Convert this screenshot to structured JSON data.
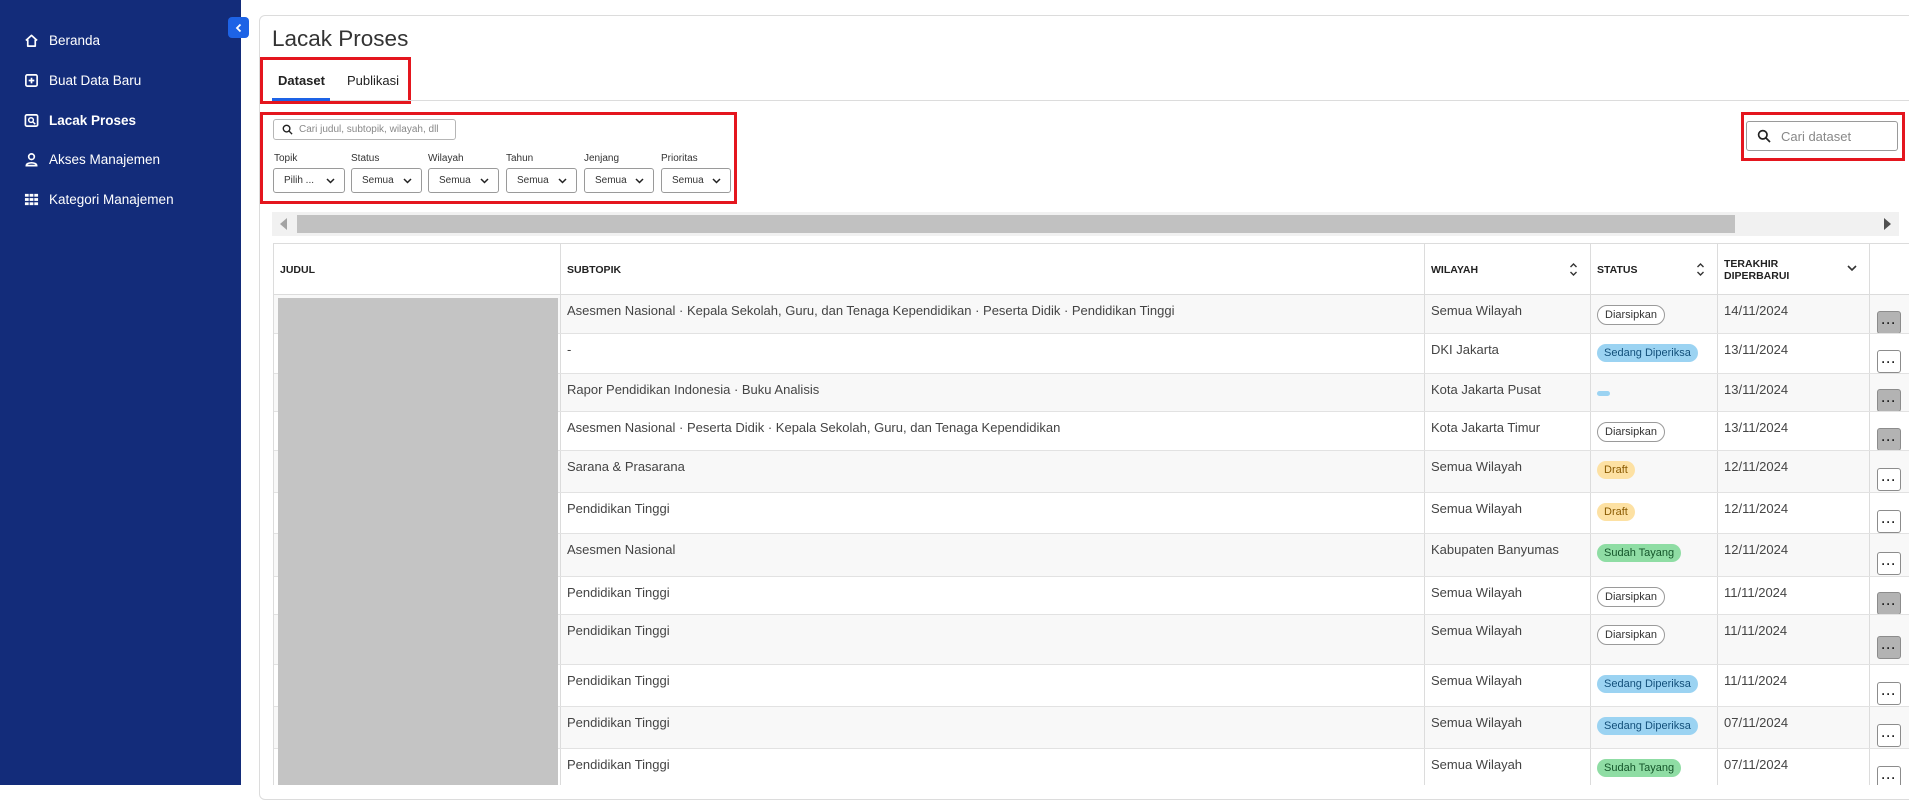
{
  "sidebar": {
    "items": [
      {
        "label": "Beranda",
        "icon": "home-icon"
      },
      {
        "label": "Buat Data Baru",
        "icon": "plus-square-icon"
      },
      {
        "label": "Lacak Proses",
        "icon": "track-search-icon",
        "active": true
      },
      {
        "label": "Akses Manajemen",
        "icon": "user-icon"
      },
      {
        "label": "Kategori Manajemen",
        "icon": "grid-icon"
      }
    ]
  },
  "page": {
    "title": "Lacak Proses"
  },
  "tabs": [
    {
      "label": "Dataset",
      "active": true
    },
    {
      "label": "Publikasi",
      "active": false
    }
  ],
  "filters": {
    "search_placeholder": "Cari judul, subtopik, wilayah, dll",
    "items": [
      {
        "label": "Topik",
        "value": "Pilih ..."
      },
      {
        "label": "Status",
        "value": "Semua"
      },
      {
        "label": "Wilayah",
        "value": "Semua"
      },
      {
        "label": "Tahun",
        "value": "Semua"
      },
      {
        "label": "Jenjang",
        "value": "Semua"
      },
      {
        "label": "Prioritas",
        "value": "Semua"
      }
    ]
  },
  "dataset_search": {
    "placeholder": "Cari dataset"
  },
  "table": {
    "headers": {
      "judul": "JUDUL",
      "subtopik": "SUBTOPIK",
      "wilayah": "WILAYAH",
      "status": "STATUS",
      "terakhir_line1": "TERAKHIR",
      "terakhir_line2": "DIPERBARUI"
    },
    "rows": [
      {
        "subtopik": "Asesmen Nasional  ·  Kepala Sekolah, Guru, dan Tenaga Kependidikan  ·  Peserta Didik  ·  Pendidikan Tinggi",
        "wilayah": "Semua Wilayah",
        "status": "Diarsipkan",
        "status_style": "outline",
        "date": "14/11/2024",
        "more_grey": true
      },
      {
        "subtopik": "-",
        "wilayah": "DKI Jakarta",
        "status": "Sedang Diperiksa",
        "status_style": "blue",
        "date": "13/11/2024",
        "more_grey": false
      },
      {
        "subtopik": "Rapor Pendidikan Indonesia  ·  Buku Analisis",
        "wilayah": "Kota Jakarta Pusat",
        "status": "",
        "status_style": "dash",
        "date": "13/11/2024",
        "more_grey": true
      },
      {
        "subtopik": "Asesmen Nasional  ·  Peserta Didik  ·  Kepala Sekolah, Guru, dan Tenaga Kependidikan",
        "wilayah": "Kota Jakarta Timur",
        "status": "Diarsipkan",
        "status_style": "outline",
        "date": "13/11/2024",
        "more_grey": true
      },
      {
        "subtopik": "Sarana & Prasarana",
        "wilayah": "Semua Wilayah",
        "status": "Draft",
        "status_style": "yellow",
        "date": "12/11/2024",
        "more_grey": false
      },
      {
        "subtopik": "Pendidikan Tinggi",
        "wilayah": "Semua Wilayah",
        "status": "Draft",
        "status_style": "yellow",
        "date": "12/11/2024",
        "more_grey": false
      },
      {
        "subtopik": "Asesmen Nasional",
        "wilayah": "Kabupaten Banyumas",
        "status": "Sudah Tayang",
        "status_style": "green",
        "date": "12/11/2024",
        "more_grey": false
      },
      {
        "subtopik": "Pendidikan Tinggi",
        "wilayah": "Semua Wilayah",
        "status": "Diarsipkan",
        "status_style": "outline",
        "date": "11/11/2024",
        "more_grey": true
      },
      {
        "subtopik": "Pendidikan Tinggi",
        "wilayah": "Semua Wilayah",
        "status": "Diarsipkan",
        "status_style": "outline",
        "date": "11/11/2024",
        "more_grey": true
      },
      {
        "subtopik": "Pendidikan Tinggi",
        "wilayah": "Semua Wilayah",
        "status": "Sedang Diperiksa",
        "status_style": "blue",
        "date": "11/11/2024",
        "more_grey": false
      },
      {
        "subtopik": "Pendidikan Tinggi",
        "wilayah": "Semua Wilayah",
        "status": "Sedang Diperiksa",
        "status_style": "blue",
        "date": "07/11/2024",
        "more_grey": false
      },
      {
        "subtopik": "Pendidikan Tinggi",
        "wilayah": "Semua Wilayah",
        "status": "Sudah Tayang",
        "status_style": "green",
        "date": "07/11/2024",
        "more_grey": false
      }
    ]
  },
  "colors": {
    "sidebar_bg": "#132c7a",
    "accent": "#1d63e6",
    "highlight": "#e4161e"
  }
}
